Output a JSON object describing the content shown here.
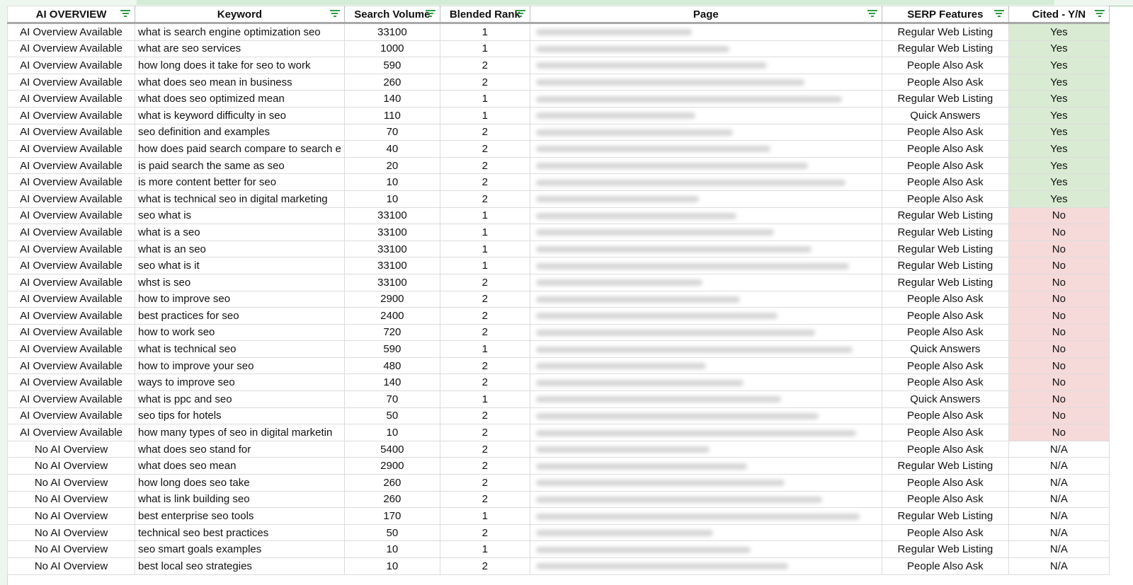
{
  "columns": [
    {
      "label": "AI OVERVIEW"
    },
    {
      "label": "Keyword"
    },
    {
      "label": "Search Volume"
    },
    {
      "label": "Blended Rank"
    },
    {
      "label": "Page"
    },
    {
      "label": "SERP Features"
    },
    {
      "label": "Cited - Y/N"
    }
  ],
  "colors": {
    "yes_fill": "#d9ebd3",
    "no_fill": "#f6d9d9",
    "filter_icon": "#2c9b41"
  },
  "rows": [
    {
      "ai": "AI Overview Available",
      "keyword": "what is search engine optimization seo",
      "volume": "33100",
      "rank": "1",
      "page": "[blurred url]",
      "serp": "Regular Web Listing",
      "cited": "Yes"
    },
    {
      "ai": "AI Overview Available",
      "keyword": "what are seo services",
      "volume": "1000",
      "rank": "1",
      "page": "[blurred url]",
      "serp": "Regular Web Listing",
      "cited": "Yes"
    },
    {
      "ai": "AI Overview Available",
      "keyword": "how long does it take for seo to work",
      "volume": "590",
      "rank": "2",
      "page": "[blurred url]",
      "serp": "People Also Ask",
      "cited": "Yes"
    },
    {
      "ai": "AI Overview Available",
      "keyword": "what does seo mean in business",
      "volume": "260",
      "rank": "2",
      "page": "[blurred url]",
      "serp": "People Also Ask",
      "cited": "Yes"
    },
    {
      "ai": "AI Overview Available",
      "keyword": "what does seo optimized mean",
      "volume": "140",
      "rank": "1",
      "page": "[blurred url]",
      "serp": "Regular Web Listing",
      "cited": "Yes"
    },
    {
      "ai": "AI Overview Available",
      "keyword": "what is keyword difficulty in seo",
      "volume": "110",
      "rank": "1",
      "page": "[blurred url]",
      "serp": "Quick Answers",
      "cited": "Yes"
    },
    {
      "ai": "AI Overview Available",
      "keyword": "seo definition and examples",
      "volume": "70",
      "rank": "2",
      "page": "[blurred url]",
      "serp": "People Also Ask",
      "cited": "Yes"
    },
    {
      "ai": "AI Overview Available",
      "keyword": "how does paid search compare to search e",
      "volume": "40",
      "rank": "2",
      "page": "[blurred url]",
      "serp": "People Also Ask",
      "cited": "Yes"
    },
    {
      "ai": "AI Overview Available",
      "keyword": "is paid search the same as seo",
      "volume": "20",
      "rank": "2",
      "page": "[blurred url]",
      "serp": "People Also Ask",
      "cited": "Yes"
    },
    {
      "ai": "AI Overview Available",
      "keyword": "is more content better for seo",
      "volume": "10",
      "rank": "2",
      "page": "[blurred url]",
      "serp": "People Also Ask",
      "cited": "Yes"
    },
    {
      "ai": "AI Overview Available",
      "keyword": "what is technical seo in digital marketing",
      "volume": "10",
      "rank": "2",
      "page": "[blurred url]",
      "serp": "People Also Ask",
      "cited": "Yes"
    },
    {
      "ai": "AI Overview Available",
      "keyword": "seo what is",
      "volume": "33100",
      "rank": "1",
      "page": "[blurred url]",
      "serp": "Regular Web Listing",
      "cited": "No"
    },
    {
      "ai": "AI Overview Available",
      "keyword": "what is a seo",
      "volume": "33100",
      "rank": "1",
      "page": "[blurred url]",
      "serp": "Regular Web Listing",
      "cited": "No"
    },
    {
      "ai": "AI Overview Available",
      "keyword": "what is an seo",
      "volume": "33100",
      "rank": "1",
      "page": "[blurred url]",
      "serp": "Regular Web Listing",
      "cited": "No"
    },
    {
      "ai": "AI Overview Available",
      "keyword": "seo what is it",
      "volume": "33100",
      "rank": "1",
      "page": "[blurred url]",
      "serp": "Regular Web Listing",
      "cited": "No"
    },
    {
      "ai": "AI Overview Available",
      "keyword": "whst is seo",
      "volume": "33100",
      "rank": "2",
      "page": "[blurred url]",
      "serp": "Regular Web Listing",
      "cited": "No"
    },
    {
      "ai": "AI Overview Available",
      "keyword": "how to improve seo",
      "volume": "2900",
      "rank": "2",
      "page": "[blurred url]",
      "serp": "People Also Ask",
      "cited": "No"
    },
    {
      "ai": "AI Overview Available",
      "keyword": "best practices for seo",
      "volume": "2400",
      "rank": "2",
      "page": "[blurred url]",
      "serp": "People Also Ask",
      "cited": "No"
    },
    {
      "ai": "AI Overview Available",
      "keyword": "how to work seo",
      "volume": "720",
      "rank": "2",
      "page": "[blurred url]",
      "serp": "People Also Ask",
      "cited": "No"
    },
    {
      "ai": "AI Overview Available",
      "keyword": "what is technical seo",
      "volume": "590",
      "rank": "1",
      "page": "[blurred url]",
      "serp": "Quick Answers",
      "cited": "No"
    },
    {
      "ai": "AI Overview Available",
      "keyword": "how to improve your seo",
      "volume": "480",
      "rank": "2",
      "page": "[blurred url]",
      "serp": "People Also Ask",
      "cited": "No"
    },
    {
      "ai": "AI Overview Available",
      "keyword": "ways to improve seo",
      "volume": "140",
      "rank": "2",
      "page": "[blurred url]",
      "serp": "People Also Ask",
      "cited": "No"
    },
    {
      "ai": "AI Overview Available",
      "keyword": "what is ppc and seo",
      "volume": "70",
      "rank": "1",
      "page": "[blurred url]",
      "serp": "Quick Answers",
      "cited": "No"
    },
    {
      "ai": "AI Overview Available",
      "keyword": "seo tips for hotels",
      "volume": "50",
      "rank": "2",
      "page": "[blurred url]",
      "serp": "People Also Ask",
      "cited": "No"
    },
    {
      "ai": "AI Overview Available",
      "keyword": "how many types of seo in digital marketin",
      "volume": "10",
      "rank": "2",
      "page": "[blurred url]",
      "serp": "People Also Ask",
      "cited": "No"
    },
    {
      "ai": "No AI Overview",
      "keyword": "what does seo stand for",
      "volume": "5400",
      "rank": "2",
      "page": "[blurred url]",
      "serp": "People Also Ask",
      "cited": "N/A"
    },
    {
      "ai": "No AI Overview",
      "keyword": "what does seo mean",
      "volume": "2900",
      "rank": "2",
      "page": "[blurred url]",
      "serp": "Regular Web Listing",
      "cited": "N/A"
    },
    {
      "ai": "No AI Overview",
      "keyword": "how long does seo take",
      "volume": "260",
      "rank": "2",
      "page": "[blurred url]",
      "serp": "People Also Ask",
      "cited": "N/A"
    },
    {
      "ai": "No AI Overview",
      "keyword": "what is link building seo",
      "volume": "260",
      "rank": "2",
      "page": "[blurred url]",
      "serp": "People Also Ask",
      "cited": "N/A"
    },
    {
      "ai": "No AI Overview",
      "keyword": "best enterprise seo tools",
      "volume": "170",
      "rank": "1",
      "page": "[blurred url]",
      "serp": "Regular Web Listing",
      "cited": "N/A"
    },
    {
      "ai": "No AI Overview",
      "keyword": "technical seo best practices",
      "volume": "50",
      "rank": "2",
      "page": "[blurred url]",
      "serp": "People Also Ask",
      "cited": "N/A"
    },
    {
      "ai": "No AI Overview",
      "keyword": "seo smart goals examples",
      "volume": "10",
      "rank": "1",
      "page": "[blurred url]",
      "serp": "Regular Web Listing",
      "cited": "N/A"
    },
    {
      "ai": "No AI Overview",
      "keyword": "best local seo strategies",
      "volume": "10",
      "rank": "2",
      "page": "[blurred url]",
      "serp": "People Also Ask",
      "cited": "N/A"
    }
  ]
}
